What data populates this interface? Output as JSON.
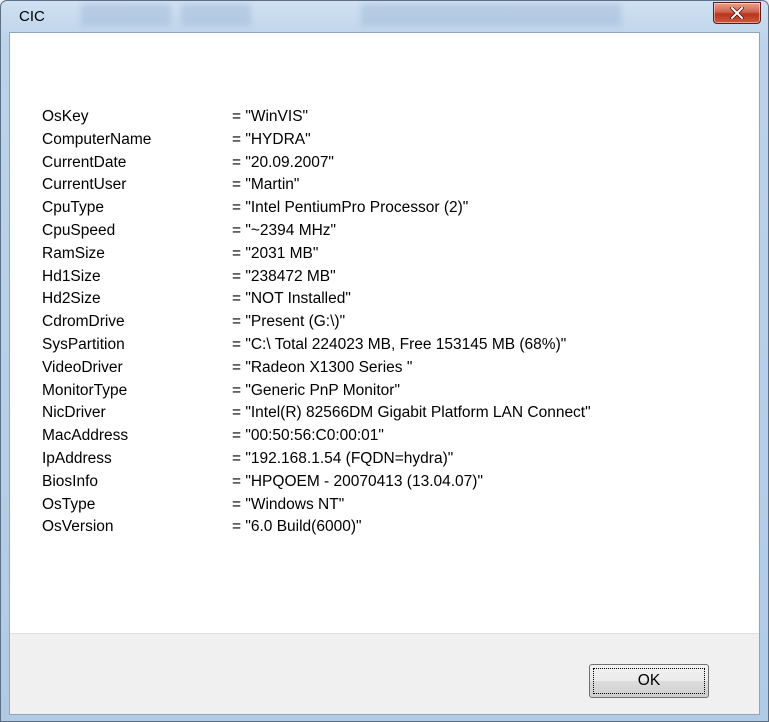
{
  "window": {
    "title": "CIC",
    "close_icon": "close-x-icon"
  },
  "info": [
    {
      "key": "OsKey",
      "value": "= \"WinVIS\""
    },
    {
      "key": "ComputerName",
      "value": "= \"HYDRA\""
    },
    {
      "key": "CurrentDate",
      "value": "= \"20.09.2007\""
    },
    {
      "key": "CurrentUser",
      "value": "= \"Martin\""
    },
    {
      "key": "CpuType",
      "value": "= \"Intel PentiumPro Processor (2)\""
    },
    {
      "key": "CpuSpeed",
      "value": "= \"~2394 MHz\""
    },
    {
      "key": "RamSize",
      "value": "= \"2031 MB\""
    },
    {
      "key": "Hd1Size",
      "value": "= \"238472 MB\""
    },
    {
      "key": "Hd2Size",
      "value": "= \"NOT Installed\""
    },
    {
      "key": "CdromDrive",
      "value": "= \"Present (G:\\)\""
    },
    {
      "key": "SysPartition",
      "value": "= \"C:\\ Total 224023 MB, Free 153145 MB (68%)\""
    },
    {
      "key": "VideoDriver",
      "value": "= \"Radeon X1300 Series \""
    },
    {
      "key": "MonitorType",
      "value": "= \"Generic PnP Monitor\""
    },
    {
      "key": "NicDriver",
      "value": "= \"Intel(R) 82566DM Gigabit Platform LAN Connect\""
    },
    {
      "key": "MacAddress",
      "value": "= \"00:50:56:C0:00:01\""
    },
    {
      "key": "IpAddress",
      "value": "= \"192.168.1.54 (FQDN=hydra)\""
    },
    {
      "key": "BiosInfo",
      "value": "= \"HPQOEM - 20070413 (13.04.07)\""
    },
    {
      "key": "OsType",
      "value": "= \"Windows NT\""
    },
    {
      "key": "OsVersion",
      "value": "= \"6.0 Build(6000)\""
    }
  ],
  "footer": {
    "ok_label": "OK"
  },
  "colors": {
    "titlebar": "#b2cbe5",
    "close_button": "#c8462c",
    "footer": "#f0f0f0"
  }
}
